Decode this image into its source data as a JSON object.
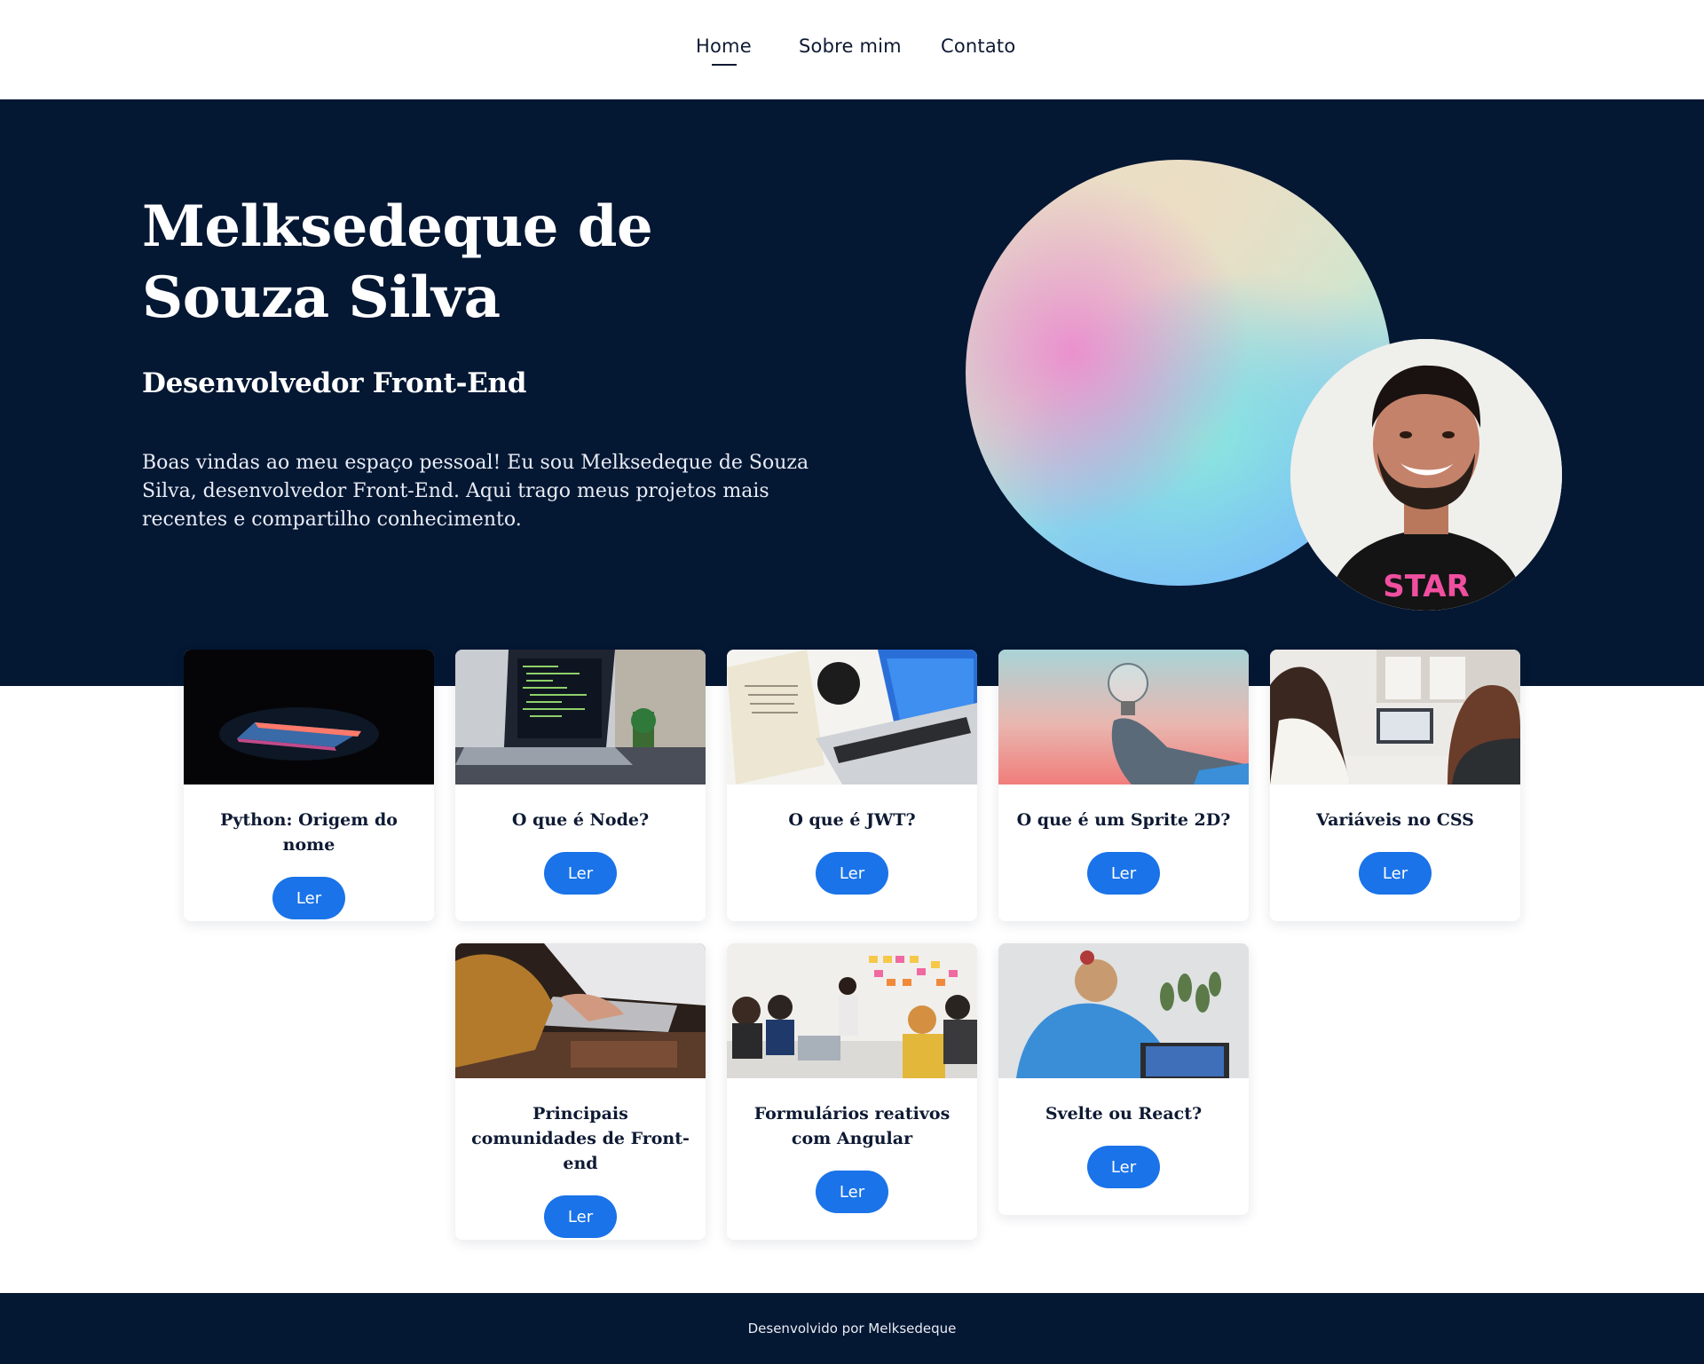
{
  "nav": {
    "home": "Home",
    "sobre": "Sobre mim",
    "contato": "Contato"
  },
  "hero": {
    "title": "Melksedeque de Souza Silva",
    "subtitle": "Desenvolvedor Front-End",
    "description": "Boas vindas ao meu espaço pessoal! Eu sou Melksedeque de Souza Silva, desenvolvedor Front-End. Aqui trago meus projetos mais recentes e compartilho conhecimento.",
    "shirt_text": "STAR"
  },
  "posts": [
    {
      "title": "Python: Origem do nome",
      "button": "Ler"
    },
    {
      "title": "O que é Node?",
      "button": "Ler"
    },
    {
      "title": "O que é JWT?",
      "button": "Ler"
    },
    {
      "title": "O que é um Sprite 2D?",
      "button": "Ler"
    },
    {
      "title": "Variáveis no CSS",
      "button": "Ler"
    },
    {
      "title": "Principais comunidades de Front-end",
      "button": "Ler"
    },
    {
      "title": "Formulários reativos com Angular",
      "button": "Ler"
    },
    {
      "title": "Svelte ou React?",
      "button": "Ler"
    }
  ],
  "footer": {
    "text": "Desenvolvido por Melksedeque"
  },
  "colors": {
    "navy": "#041733",
    "button_blue": "#1a73e8",
    "text_dark": "#0e1a33"
  }
}
